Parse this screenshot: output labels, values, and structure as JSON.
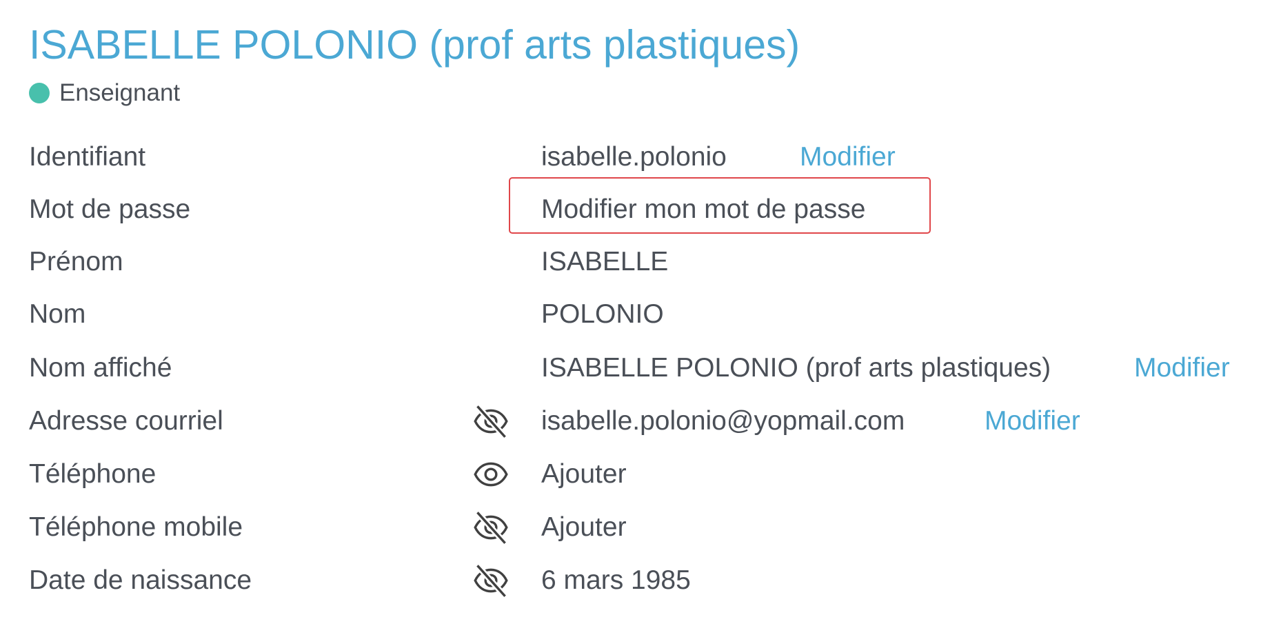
{
  "header": {
    "title": "ISABELLE POLONIO (prof arts plastiques)",
    "status_label": "Enseignant",
    "status_color": "#48c0ac"
  },
  "colors": {
    "accent": "#4ba8d4",
    "text": "#4a4f57",
    "highlight": "#e0464a"
  },
  "fields": [
    {
      "label": "Identifiant",
      "value": "isabelle.polonio",
      "action": "Modifier"
    },
    {
      "label": "Mot de passe",
      "link": "Modifier mon mot de passe"
    },
    {
      "label": "Prénom",
      "value": "ISABELLE"
    },
    {
      "label": "Nom",
      "value": "POLONIO"
    },
    {
      "label": "Nom affiché",
      "value": "ISABELLE POLONIO (prof arts plastiques)",
      "action": "Modifier"
    },
    {
      "label": "Adresse courriel",
      "visibility_icon": "eye-off-icon",
      "value": "isabelle.polonio@yopmail.com",
      "action": "Modifier"
    },
    {
      "label": "Téléphone",
      "visibility_icon": "eye-icon",
      "link": "Ajouter"
    },
    {
      "label": "Téléphone mobile",
      "visibility_icon": "eye-off-icon",
      "link": "Ajouter"
    },
    {
      "label": "Date de naissance",
      "visibility_icon": "eye-off-icon",
      "value": "6 mars 1985"
    }
  ]
}
